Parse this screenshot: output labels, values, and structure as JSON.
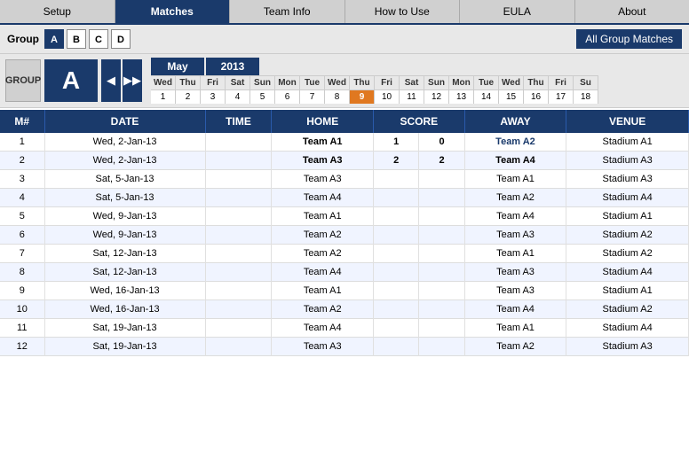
{
  "nav": {
    "tabs": [
      {
        "label": "Setup",
        "active": false
      },
      {
        "label": "Matches",
        "active": true
      },
      {
        "label": "Team Info",
        "active": false
      },
      {
        "label": "How to Use",
        "active": false
      },
      {
        "label": "EULA",
        "active": false
      },
      {
        "label": "About",
        "active": false
      }
    ]
  },
  "groupRow": {
    "label": "Group",
    "buttons": [
      "A",
      "B",
      "C",
      "D"
    ],
    "active": "A",
    "allGroupBtn": "All Group Matches"
  },
  "calendar": {
    "groupLabel": "GROUP",
    "groupLetter": "A",
    "month": "May",
    "year": "2013",
    "dayHeaders": [
      "Wed",
      "Thu",
      "Fri",
      "Sat",
      "Sun",
      "Mon",
      "Tue",
      "Wed",
      "Thu",
      "Fri",
      "Sat",
      "Sun",
      "Mon",
      "Tue",
      "Wed",
      "Thu",
      "Fri",
      "Su"
    ],
    "dayNums": [
      "1",
      "2",
      "3",
      "4",
      "5",
      "6",
      "7",
      "8",
      "9",
      "10",
      "11",
      "12",
      "13",
      "14",
      "15",
      "16",
      "17",
      "18"
    ],
    "todayIndex": 8
  },
  "table": {
    "headers": [
      "M#",
      "DATE",
      "TIME",
      "HOME",
      "SCORE",
      "",
      "AWAY",
      "VENUE"
    ],
    "rows": [
      {
        "m": "1",
        "date": "Wed, 2-Jan-13",
        "time": "",
        "home": "Team A1",
        "scoreH": "1",
        "scoreA": "0",
        "away": "Team A2",
        "venue": "Stadium A1",
        "homeBold": true,
        "awayBlue": true
      },
      {
        "m": "2",
        "date": "Wed, 2-Jan-13",
        "time": "",
        "home": "Team A3",
        "scoreH": "2",
        "scoreA": "2",
        "away": "Team A4",
        "venue": "Stadium A3",
        "homeBold": true,
        "awayBold": true
      },
      {
        "m": "3",
        "date": "Sat, 5-Jan-13",
        "time": "",
        "home": "Team A3",
        "scoreH": "",
        "scoreA": "",
        "away": "Team A1",
        "venue": "Stadium A3",
        "homeBold": false,
        "awayBold": false
      },
      {
        "m": "4",
        "date": "Sat, 5-Jan-13",
        "time": "",
        "home": "Team A4",
        "scoreH": "",
        "scoreA": "",
        "away": "Team A2",
        "venue": "Stadium A4",
        "homeBold": false,
        "awayBold": false
      },
      {
        "m": "5",
        "date": "Wed, 9-Jan-13",
        "time": "",
        "home": "Team A1",
        "scoreH": "",
        "scoreA": "",
        "away": "Team A4",
        "venue": "Stadium A1",
        "homeBold": false,
        "awayBold": false
      },
      {
        "m": "6",
        "date": "Wed, 9-Jan-13",
        "time": "",
        "home": "Team A2",
        "scoreH": "",
        "scoreA": "",
        "away": "Team A3",
        "venue": "Stadium A2",
        "homeBold": false,
        "awayBold": false
      },
      {
        "m": "7",
        "date": "Sat, 12-Jan-13",
        "time": "",
        "home": "Team A2",
        "scoreH": "",
        "scoreA": "",
        "away": "Team A1",
        "venue": "Stadium A2",
        "homeBold": false,
        "awayBold": false
      },
      {
        "m": "8",
        "date": "Sat, 12-Jan-13",
        "time": "",
        "home": "Team A4",
        "scoreH": "",
        "scoreA": "",
        "away": "Team A3",
        "venue": "Stadium A4",
        "homeBold": false,
        "awayBold": false
      },
      {
        "m": "9",
        "date": "Wed, 16-Jan-13",
        "time": "",
        "home": "Team A1",
        "scoreH": "",
        "scoreA": "",
        "away": "Team A3",
        "venue": "Stadium A1",
        "homeBold": false,
        "awayBold": false
      },
      {
        "m": "10",
        "date": "Wed, 16-Jan-13",
        "time": "",
        "home": "Team A2",
        "scoreH": "",
        "scoreA": "",
        "away": "Team A4",
        "venue": "Stadium A2",
        "homeBold": false,
        "awayBold": false
      },
      {
        "m": "11",
        "date": "Sat, 19-Jan-13",
        "time": "",
        "home": "Team A4",
        "scoreH": "",
        "scoreA": "",
        "away": "Team A1",
        "venue": "Stadium A4",
        "homeBold": false,
        "awayBold": false
      },
      {
        "m": "12",
        "date": "Sat, 19-Jan-13",
        "time": "",
        "home": "Team A3",
        "scoreH": "",
        "scoreA": "",
        "away": "Team A2",
        "venue": "Stadium A3",
        "homeBold": false,
        "awayBold": false
      }
    ]
  }
}
